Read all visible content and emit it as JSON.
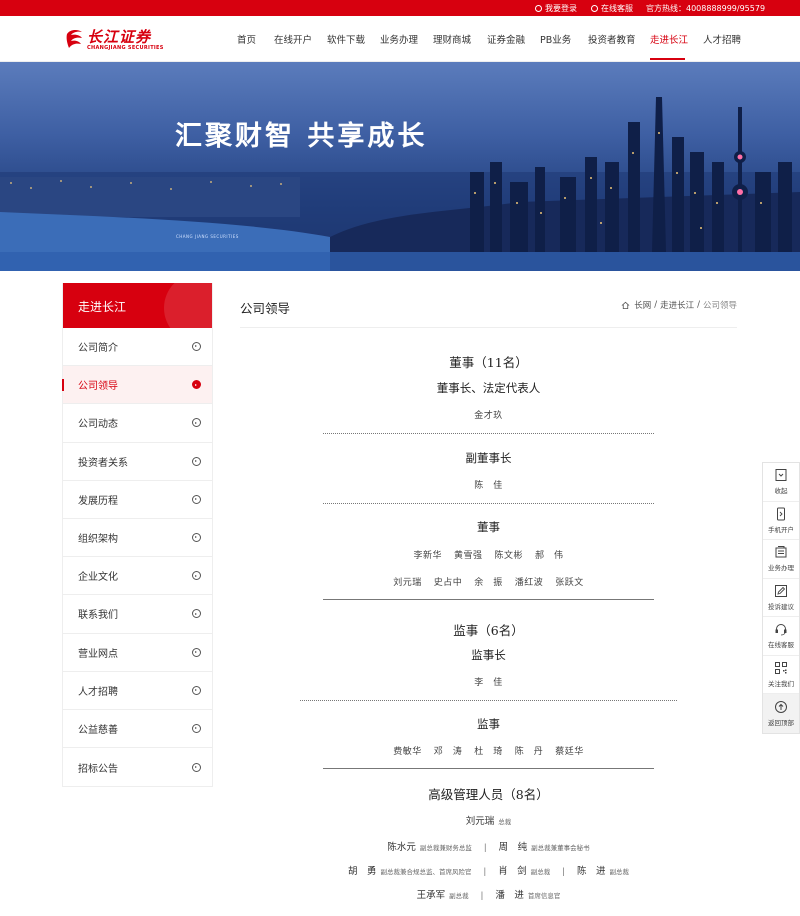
{
  "topbar": {
    "login": "我要登录",
    "service": "在线客服",
    "hotline": "官方热线：4008888999/95579"
  },
  "logo": {
    "cn": "长江证券",
    "en": "CHANGJIANG SECURITIES"
  },
  "nav": {
    "items": [
      "首页",
      "在线开户",
      "软件下载",
      "业务办理",
      "理财商城",
      "证券金融",
      "PB业务",
      "投资者教育",
      "走进长江",
      "人才招聘"
    ],
    "active": "走进长江"
  },
  "banner": {
    "slogan": "汇聚财智 共享成长",
    "sub_logo": "CHANG JIANG SECURITIES"
  },
  "sidebar": {
    "title": "走进长江",
    "items": [
      "公司简介",
      "公司领导",
      "公司动态",
      "投资者关系",
      "发展历程",
      "组织架构",
      "企业文化",
      "联系我们",
      "营业网点",
      "人才招聘",
      "公益慈善",
      "招标公告"
    ],
    "active": "公司领导"
  },
  "content": {
    "title": "公司领导",
    "breadcrumb": [
      "长网",
      "走进长江",
      "公司领导"
    ],
    "board": {
      "title": "董事（11名）",
      "chair_title": "董事长、法定代表人",
      "chair": "金才玖",
      "vice_title": "副董事长",
      "vice": "陈　佳",
      "director_title": "董事",
      "directors_row1": [
        "李新华",
        "黄雪强",
        "陈文彬",
        "郝　伟"
      ],
      "directors_row2": [
        "刘元瑞",
        "史占中",
        "余　振",
        "潘红波",
        "张跃文"
      ]
    },
    "supervisors": {
      "title": "监事（6名）",
      "chief_title": "监事长",
      "chief": "李　佳",
      "member_title": "监事",
      "members": [
        "费敏华",
        "邓　涛",
        "杜　琦",
        "陈　丹",
        "蔡廷华"
      ]
    },
    "management": {
      "title": "高级管理人员（8名）",
      "row1": [
        {
          "name": "刘元瑞",
          "role": "总裁"
        }
      ],
      "row2": [
        {
          "name": "陈水元",
          "role": "副总裁兼财务总监"
        },
        {
          "name": "周　纯",
          "role": "副总裁兼董事会秘书"
        }
      ],
      "row3": [
        {
          "name": "胡　勇",
          "role": "副总裁兼合规总监、首席风险官"
        },
        {
          "name": "肖　剑",
          "role": "副总裁"
        },
        {
          "name": "陈　进",
          "role": "副总裁"
        }
      ],
      "row4": [
        {
          "name": "王承军",
          "role": "副总裁"
        },
        {
          "name": "潘　进",
          "role": "首席信息官"
        }
      ]
    }
  },
  "floatbar": {
    "items": [
      "收起",
      "手机开户",
      "业务办理",
      "投诉建议",
      "在线客服",
      "关注我们",
      "返回顶部"
    ]
  },
  "colors": {
    "brand_red": "#d7000f"
  }
}
